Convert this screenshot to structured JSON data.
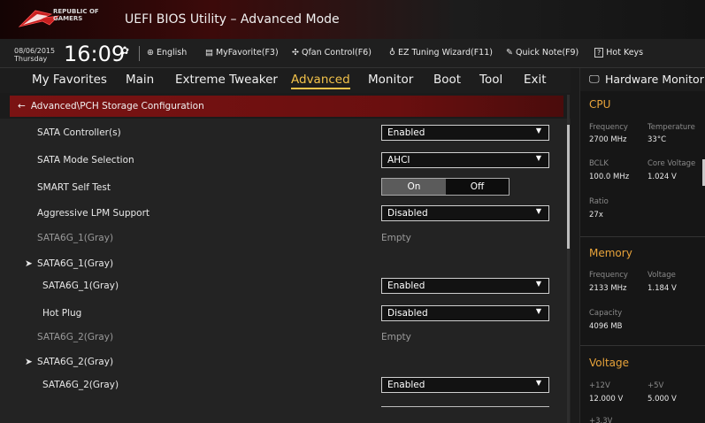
{
  "header": {
    "brand_line1": "REPUBLIC OF",
    "brand_line2": "GAMERS",
    "title": "UEFI BIOS Utility – Advanced Mode"
  },
  "toolbar": {
    "date": "08/06/2015",
    "day": "Thursday",
    "time": "16:09",
    "language": "English",
    "myfavorite": "MyFavorite(F3)",
    "qfan": "Qfan Control(F6)",
    "ez_tuning": "EZ Tuning Wizard(F11)",
    "quick_note": "Quick Note(F9)",
    "hot_keys": "Hot Keys"
  },
  "nav": {
    "tabs": [
      "My Favorites",
      "Main",
      "Extreme Tweaker",
      "Advanced",
      "Monitor",
      "Boot",
      "Tool",
      "Exit"
    ],
    "active": "Advanced"
  },
  "breadcrumb": "Advanced\\PCH Storage Configuration",
  "settings": [
    {
      "label": "SATA Controller(s)",
      "value": "Enabled"
    },
    {
      "label": "SATA Mode Selection",
      "value": "AHCI"
    },
    {
      "label": "SMART Self Test",
      "on": "On",
      "off": "Off",
      "state": "On"
    },
    {
      "label": "Aggressive LPM Support",
      "value": "Disabled"
    },
    {
      "label": "SATA6G_1(Gray)",
      "value": "Empty"
    },
    {
      "label": "SATA6G_1(Gray)"
    },
    {
      "label": "SATA6G_1(Gray)",
      "value": "Enabled"
    },
    {
      "label": "Hot Plug",
      "value": "Disabled"
    },
    {
      "label": "SATA6G_2(Gray)",
      "value": "Empty"
    },
    {
      "label": "SATA6G_2(Gray)"
    },
    {
      "label": "SATA6G_2(Gray)",
      "value": "Enabled"
    }
  ],
  "hardware_monitor": {
    "title": "Hardware Monitor",
    "cpu": {
      "title": "CPU",
      "frequency_label": "Frequency",
      "frequency": "2700 MHz",
      "temperature_label": "Temperature",
      "temperature": "33°C",
      "bclk_label": "BCLK",
      "bclk": "100.0 MHz",
      "core_voltage_label": "Core Voltage",
      "core_voltage": "1.024 V",
      "ratio_label": "Ratio",
      "ratio": "27x"
    },
    "memory": {
      "title": "Memory",
      "frequency_label": "Frequency",
      "frequency": "2133 MHz",
      "voltage_label": "Voltage",
      "voltage": "1.184 V",
      "capacity_label": "Capacity",
      "capacity": "4096 MB"
    },
    "voltage": {
      "title": "Voltage",
      "v12_label": "+12V",
      "v12": "12.000 V",
      "v5_label": "+5V",
      "v5": "5.000 V",
      "v33_label": "+3.3V"
    }
  },
  "colors": {
    "accent": "#f2c24a",
    "section": "#e8a33a",
    "breadcrumb_bg": "#7a1313"
  }
}
